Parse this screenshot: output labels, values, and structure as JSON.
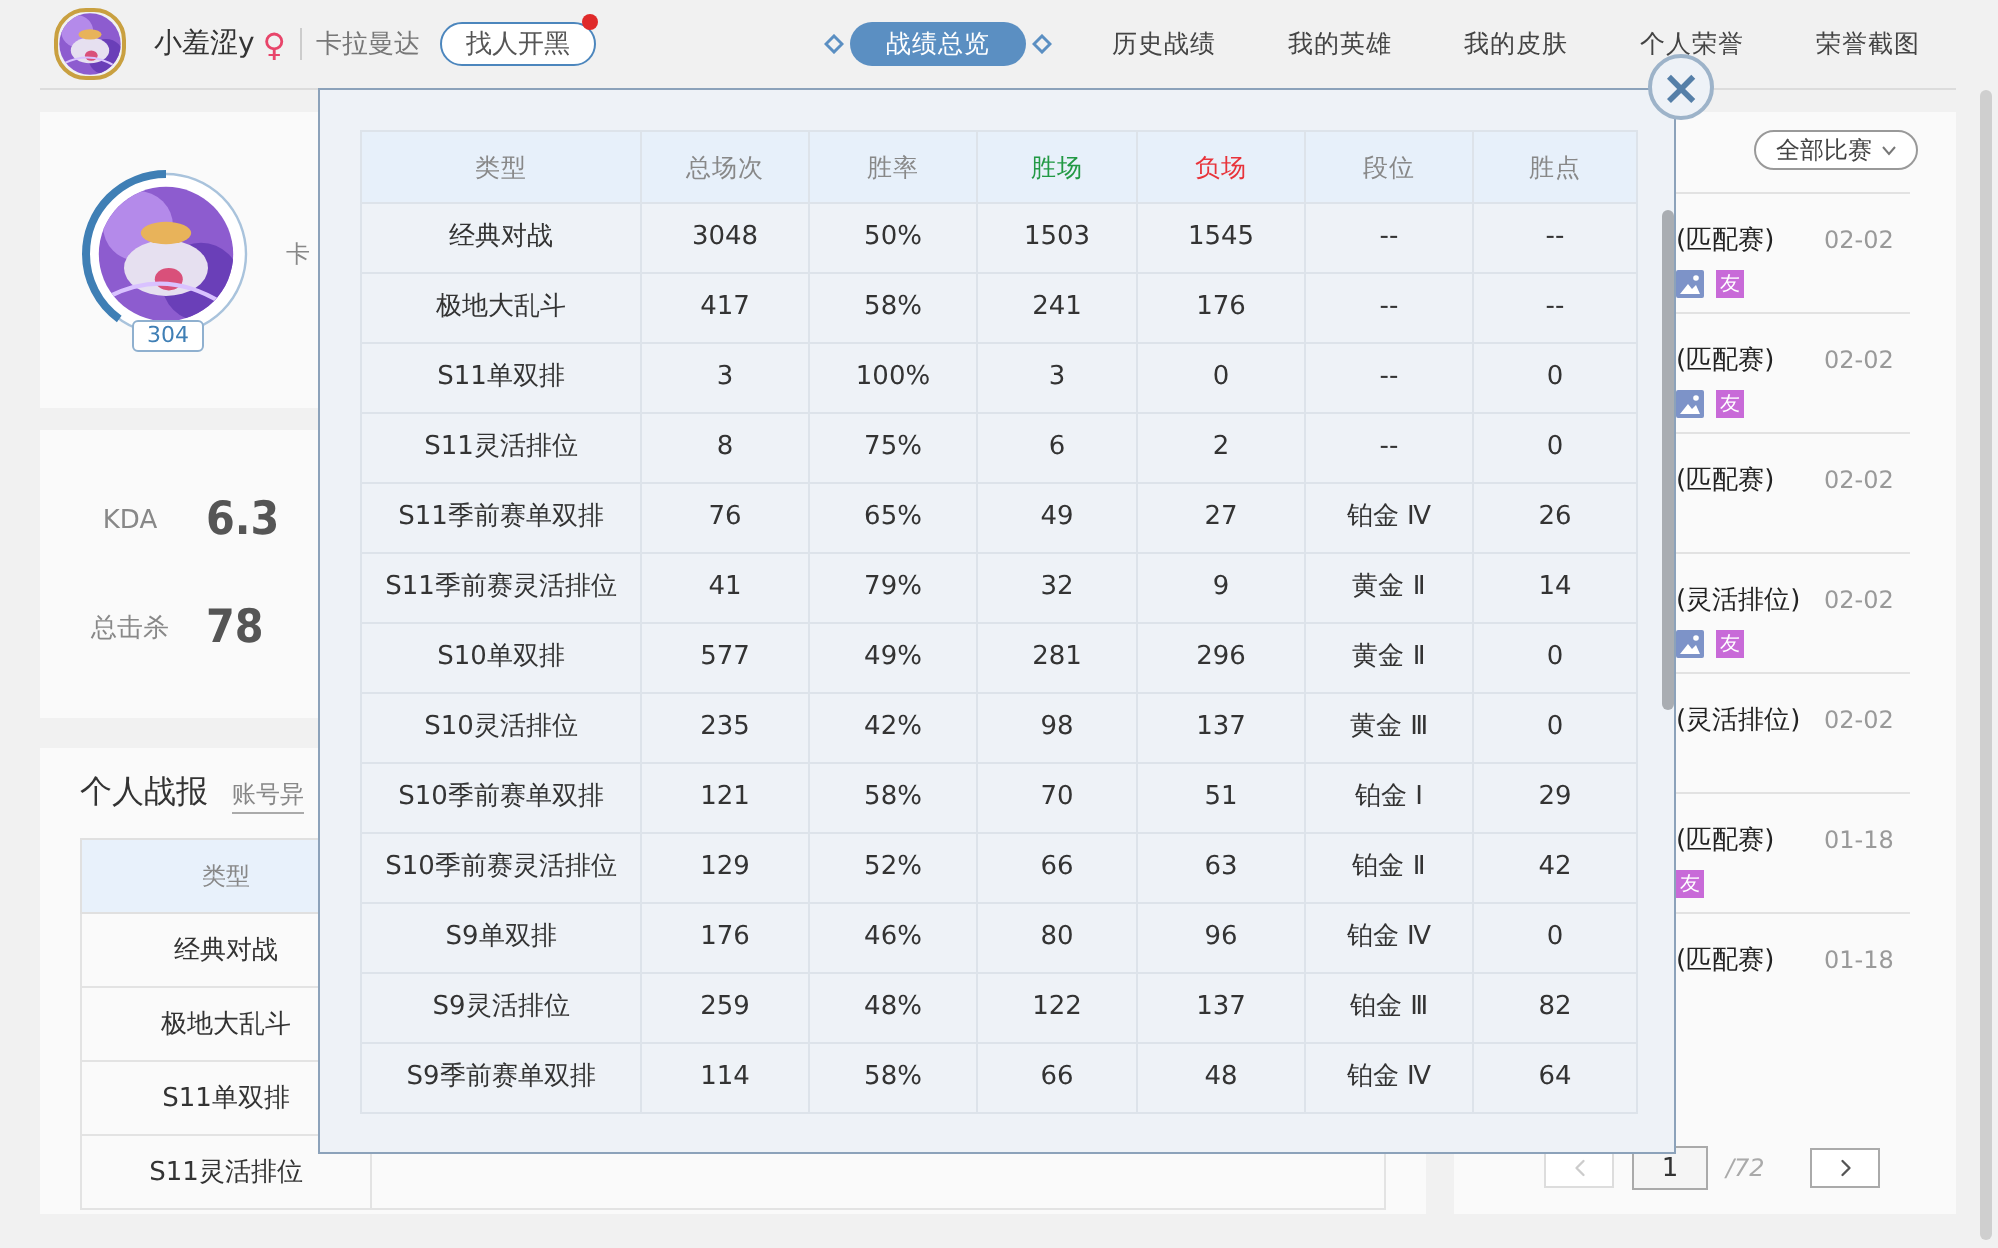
{
  "user": {
    "name": "小羞涩y",
    "gender": "♀",
    "server": "卡拉曼达",
    "find_button": "找人开黑",
    "notification": true
  },
  "nav_tabs": [
    {
      "label": "战绩总览",
      "selected": true
    },
    {
      "label": "历史战绩",
      "selected": false
    },
    {
      "label": "我的英雄",
      "selected": false
    },
    {
      "label": "我的皮肤",
      "selected": false
    },
    {
      "label": "个人荣誉",
      "selected": false
    },
    {
      "label": "荣誉截图",
      "selected": false
    }
  ],
  "profile": {
    "server": "卡",
    "level_badge": "304",
    "level": 0.4
  },
  "stats": [
    {
      "label": "KDA",
      "value": "6.3"
    },
    {
      "label": "总击杀",
      "value": "78"
    }
  ],
  "report": {
    "title": "个人战报",
    "link": "账号异",
    "header": "类型",
    "rows": [
      "经典对战",
      "极地大乱斗",
      "S11单双排",
      "S11灵活排位"
    ]
  },
  "match_filter": "全部比赛",
  "matches": [
    {
      "mode": "(匹配赛)",
      "date": "02-02",
      "photo": true,
      "friend": "友"
    },
    {
      "mode": "(匹配赛)",
      "date": "02-02",
      "photo": true,
      "friend": "友"
    },
    {
      "mode": "(匹配赛)",
      "date": "02-02",
      "photo": false
    },
    {
      "mode": "(灵活排位)",
      "date": "02-02",
      "photo": true,
      "friend": "友"
    },
    {
      "mode": "(灵活排位)",
      "date": "02-02",
      "photo": false
    },
    {
      "mode": "(匹配赛)",
      "date": "01-18",
      "photo": false,
      "friend": "友"
    },
    {
      "mode": "(匹配赛)",
      "date": "01-18",
      "photo": false
    }
  ],
  "pagination": {
    "page": "1",
    "total": "/72"
  },
  "modal": {
    "close": "×",
    "columns": [
      {
        "label": "类型",
        "color": "#888888"
      },
      {
        "label": "总场次",
        "color": "#888888"
      },
      {
        "label": "胜率",
        "color": "#888888"
      },
      {
        "label": "胜场",
        "color": "#229944"
      },
      {
        "label": "负场",
        "color": "#e8333a"
      },
      {
        "label": "段位",
        "color": "#888888"
      },
      {
        "label": "胜点",
        "color": "#888888"
      }
    ],
    "rows": [
      [
        "经典对战",
        "3048",
        "50%",
        "1503",
        "1545",
        "--",
        "--"
      ],
      [
        "极地大乱斗",
        "417",
        "58%",
        "241",
        "176",
        "--",
        "--"
      ],
      [
        "S11单双排",
        "3",
        "100%",
        "3",
        "0",
        "--",
        "0"
      ],
      [
        "S11灵活排位",
        "8",
        "75%",
        "6",
        "2",
        "--",
        "0"
      ],
      [
        "S11季前赛单双排",
        "76",
        "65%",
        "49",
        "27",
        "铂金 Ⅳ",
        "26"
      ],
      [
        "S11季前赛灵活排位",
        "41",
        "79%",
        "32",
        "9",
        "黄金 Ⅱ",
        "14"
      ],
      [
        "S10单双排",
        "577",
        "49%",
        "281",
        "296",
        "黄金 Ⅱ",
        "0"
      ],
      [
        "S10灵活排位",
        "235",
        "42%",
        "98",
        "137",
        "黄金 Ⅲ",
        "0"
      ],
      [
        "S10季前赛单双排",
        "121",
        "58%",
        "70",
        "51",
        "铂金 Ⅰ",
        "29"
      ],
      [
        "S10季前赛灵活排位",
        "129",
        "52%",
        "66",
        "63",
        "铂金 Ⅱ",
        "42"
      ],
      [
        "S9单双排",
        "176",
        "46%",
        "80",
        "96",
        "铂金 Ⅳ",
        "0"
      ],
      [
        "S9灵活排位",
        "259",
        "48%",
        "122",
        "137",
        "铂金 Ⅲ",
        "82"
      ],
      [
        "S9季前赛单双排",
        "114",
        "58%",
        "66",
        "48",
        "铂金 Ⅳ",
        "64"
      ]
    ]
  }
}
